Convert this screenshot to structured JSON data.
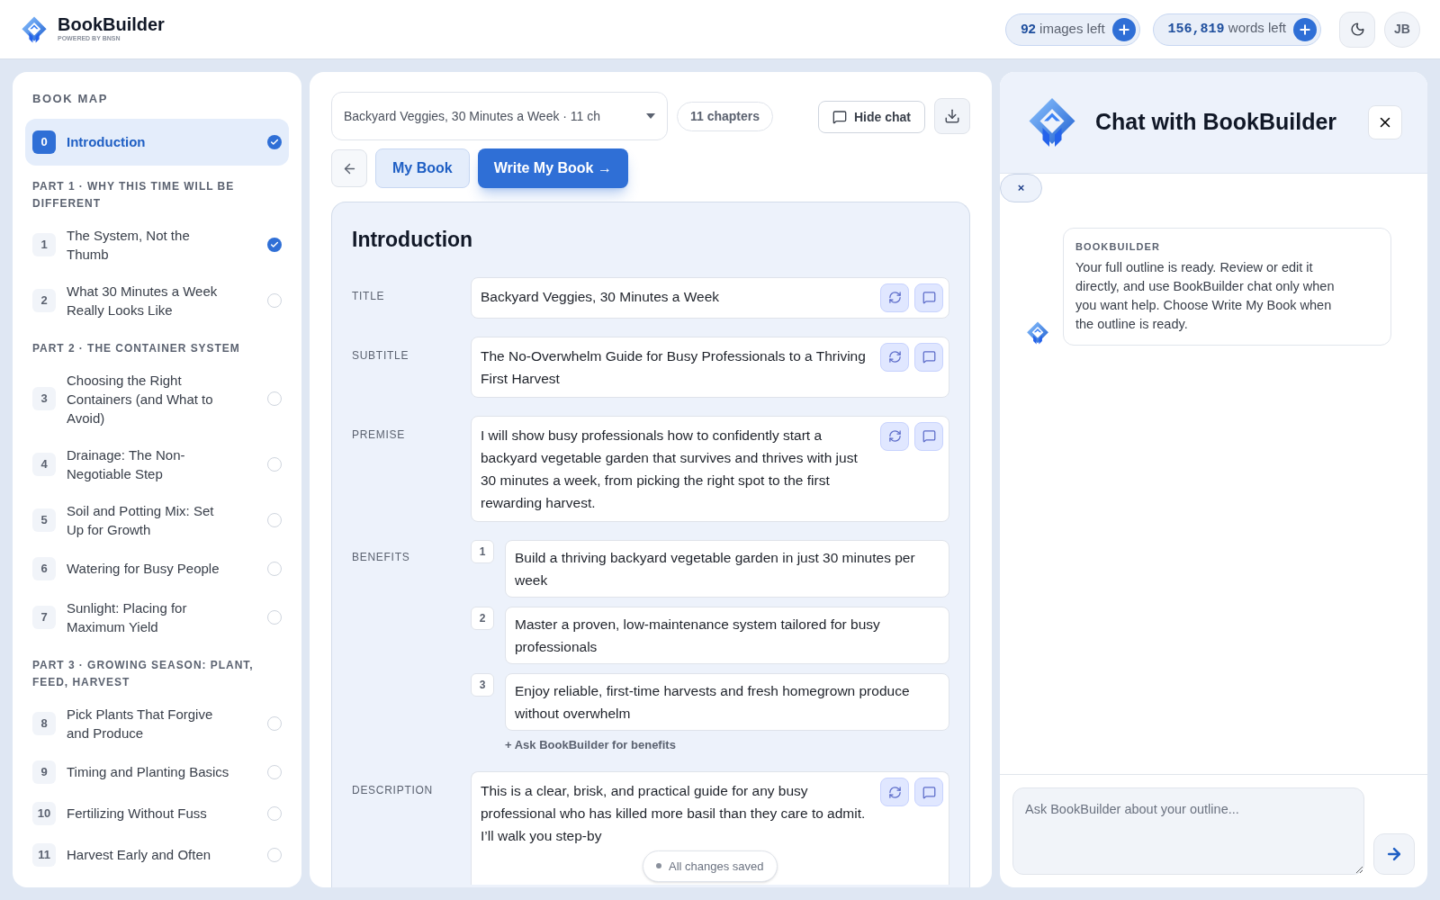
{
  "header": {
    "brand": "BookBuilder",
    "tagline": "POWERED BY BNSN",
    "images": {
      "count": "92",
      "label": "images left"
    },
    "words": {
      "count": "156,819",
      "label": "words left"
    },
    "avatar": "JB"
  },
  "sidebar": {
    "heading": "BOOK MAP",
    "items": [
      {
        "kind": "chapter",
        "number": "0",
        "title": "Introduction",
        "selected": true,
        "done": true
      },
      {
        "kind": "part",
        "title": "PART 1 · WHY THIS TIME WILL BE DIFFERENT"
      },
      {
        "kind": "chapter",
        "number": "1",
        "title": "The System, Not the Thumb",
        "selected": false,
        "done": true
      },
      {
        "kind": "chapter",
        "number": "2",
        "title": "What 30 Minutes a Week Really Looks Like",
        "selected": false,
        "done": false
      },
      {
        "kind": "part",
        "title": "PART 2 · THE CONTAINER SYSTEM"
      },
      {
        "kind": "chapter",
        "number": "3",
        "title": "Choosing the Right Containers (and What to Avoid)",
        "selected": false,
        "done": false
      },
      {
        "kind": "chapter",
        "number": "4",
        "title": "Drainage: The Non-Negotiable Step",
        "selected": false,
        "done": false
      },
      {
        "kind": "chapter",
        "number": "5",
        "title": "Soil and Potting Mix: Set Up for Growth",
        "selected": false,
        "done": false
      },
      {
        "kind": "chapter",
        "number": "6",
        "title": "Watering for Busy People",
        "selected": false,
        "done": false
      },
      {
        "kind": "chapter",
        "number": "7",
        "title": "Sunlight: Placing for Maximum Yield",
        "selected": false,
        "done": false
      },
      {
        "kind": "part",
        "title": "PART 3 · GROWING SEASON: PLANT, FEED, HARVEST"
      },
      {
        "kind": "chapter",
        "number": "8",
        "title": "Pick Plants That Forgive and Produce",
        "selected": false,
        "done": false
      },
      {
        "kind": "chapter",
        "number": "9",
        "title": "Timing and Planting Basics",
        "selected": false,
        "done": false
      },
      {
        "kind": "chapter",
        "number": "10",
        "title": "Fertilizing Without Fuss",
        "selected": false,
        "done": false
      },
      {
        "kind": "chapter",
        "number": "11",
        "title": "Harvest Early and Often",
        "selected": false,
        "done": false
      }
    ]
  },
  "toolbar": {
    "book_select": "Backyard Veggies, 30 Minutes a Week · 11 ch",
    "chapters": "11 chapters",
    "hide_chat": "Hide chat",
    "tabs": [
      {
        "label": "My Book",
        "kind": "secondary"
      },
      {
        "label": "Write My Book →",
        "kind": "primary"
      }
    ]
  },
  "editor": {
    "heading": "Introduction",
    "fields": [
      {
        "label": "TITLE",
        "value": "Backyard Veggies, 30 Minutes a Week"
      },
      {
        "label": "SUBTITLE",
        "value": "The No-Overwhelm Guide for Busy Professionals to a Thriving First Harvest"
      },
      {
        "label": "PREMISE",
        "value": "I will show busy professionals how to confidently start a backyard vegetable garden that survives and thrives with just 30 minutes a week, from picking the right spot to the first rewarding harvest."
      }
    ],
    "benefits": {
      "label": "BENEFITS",
      "items": [
        {
          "number": "1",
          "text": "Build a thriving backyard vegetable garden in just 30 minutes per week"
        },
        {
          "number": "2",
          "text": "Master a proven, low-maintenance system tailored for busy professionals"
        },
        {
          "number": "3",
          "text": "Enjoy reliable, first-time harvests and fresh homegrown produce without overwhelm"
        }
      ],
      "ask_link": "+ Ask BookBuilder for benefits"
    },
    "description": {
      "label": "DESCRIPTION",
      "value": "This is a clear, brisk, and practical guide for any busy professional who has killed more basil than they care to admit. I’ll walk you step-by"
    }
  },
  "toast": "All changes saved",
  "chat": {
    "title": "Chat with BookBuilder",
    "chip": "×",
    "messages": [
      {
        "sender": "BOOKBUILDER",
        "text": "Your full outline is ready. Review or edit it directly, and use BookBuilder chat only when you want help. Choose Write My Book when the outline is ready."
      }
    ],
    "input": {
      "placeholder": "Ask BookBuilder about your outline..."
    }
  }
}
